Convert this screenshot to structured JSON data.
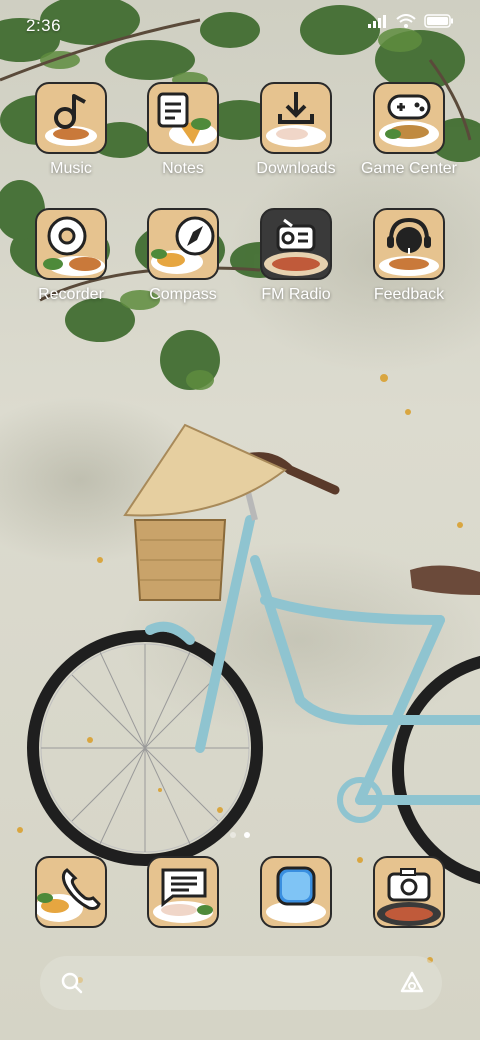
{
  "status_bar": {
    "time": "2:36",
    "icons": [
      "signal-icon",
      "wifi-icon",
      "battery-icon"
    ]
  },
  "apps": [
    {
      "label": "Music",
      "icon": "music-note-icon"
    },
    {
      "label": "Notes",
      "icon": "notes-icon"
    },
    {
      "label": "Downloads",
      "icon": "download-icon"
    },
    {
      "label": "Game Center",
      "icon": "gamepad-icon"
    },
    {
      "label": "Recorder",
      "icon": "recorder-icon"
    },
    {
      "label": "Compass",
      "icon": "compass-icon"
    },
    {
      "label": "FM Radio",
      "icon": "radio-icon"
    },
    {
      "label": "Feedback",
      "icon": "headset-icon"
    }
  ],
  "dock": [
    {
      "icon": "phone-icon"
    },
    {
      "icon": "messages-icon"
    },
    {
      "icon": "browser-icon"
    },
    {
      "icon": "camera-icon"
    }
  ],
  "page_indicator": {
    "pages": 2,
    "active": 2
  },
  "search_bar": {
    "placeholder": "",
    "left_icon": "search-icon",
    "right_icon": "assistant-icon"
  },
  "colors": {
    "icon_background": "#e6c38f",
    "icon_border": "#2a2a2a",
    "label": "#ffffff",
    "bicycle": "#8fc4d0"
  }
}
